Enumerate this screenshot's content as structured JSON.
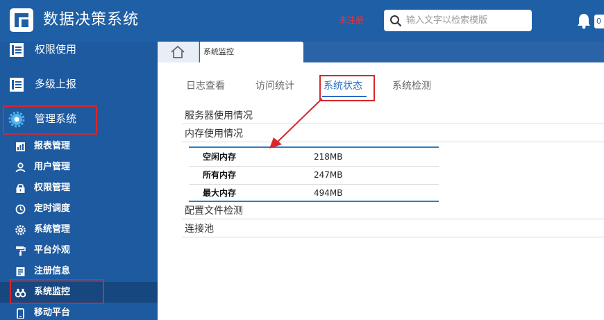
{
  "header": {
    "app_title": "数据决策系统",
    "unregistered_label": "未注册",
    "search_placeholder": "输入文字以检索模版",
    "user_label": "0"
  },
  "sidebar": {
    "items": [
      {
        "label": "权限使用",
        "icon": "document-icon"
      },
      {
        "label": "多级上报",
        "icon": "document-icon"
      },
      {
        "label": "管理系统",
        "icon": "gear-icon",
        "highlighted": true
      }
    ],
    "subitems": [
      {
        "label": "报表管理",
        "icon": "report-icon"
      },
      {
        "label": "用户管理",
        "icon": "user-icon"
      },
      {
        "label": "权限管理",
        "icon": "lock-icon"
      },
      {
        "label": "定时调度",
        "icon": "clock-icon"
      },
      {
        "label": "系统管理",
        "icon": "gear-icon"
      },
      {
        "label": "平台外观",
        "icon": "paint-roller-icon"
      },
      {
        "label": "注册信息",
        "icon": "register-icon"
      },
      {
        "label": "系统监控",
        "icon": "binoculars-icon",
        "active": true
      },
      {
        "label": "移动平台",
        "icon": "mobile-icon"
      }
    ]
  },
  "tabs_bar": {
    "page_tab_label": "系统监控"
  },
  "content": {
    "tabs": [
      {
        "label": "日志查看"
      },
      {
        "label": "访问统计"
      },
      {
        "label": "系统状态",
        "active": true
      },
      {
        "label": "系统检测"
      }
    ],
    "sections": {
      "server_usage": "服务器使用情况",
      "memory_usage": "内存使用情况",
      "config_check": "配置文件检测",
      "connection_pool": "连接池"
    },
    "memory": [
      {
        "key": "空闲内存",
        "value": "218MB"
      },
      {
        "key": "所有内存",
        "value": "247MB"
      },
      {
        "key": "最大内存",
        "value": "494MB"
      }
    ]
  },
  "colors": {
    "header_bg": "#1e5fa6",
    "sidebar_bg": "#1d5aa0",
    "accent": "#2b6fc4",
    "annotation_red": "#d9262a"
  }
}
